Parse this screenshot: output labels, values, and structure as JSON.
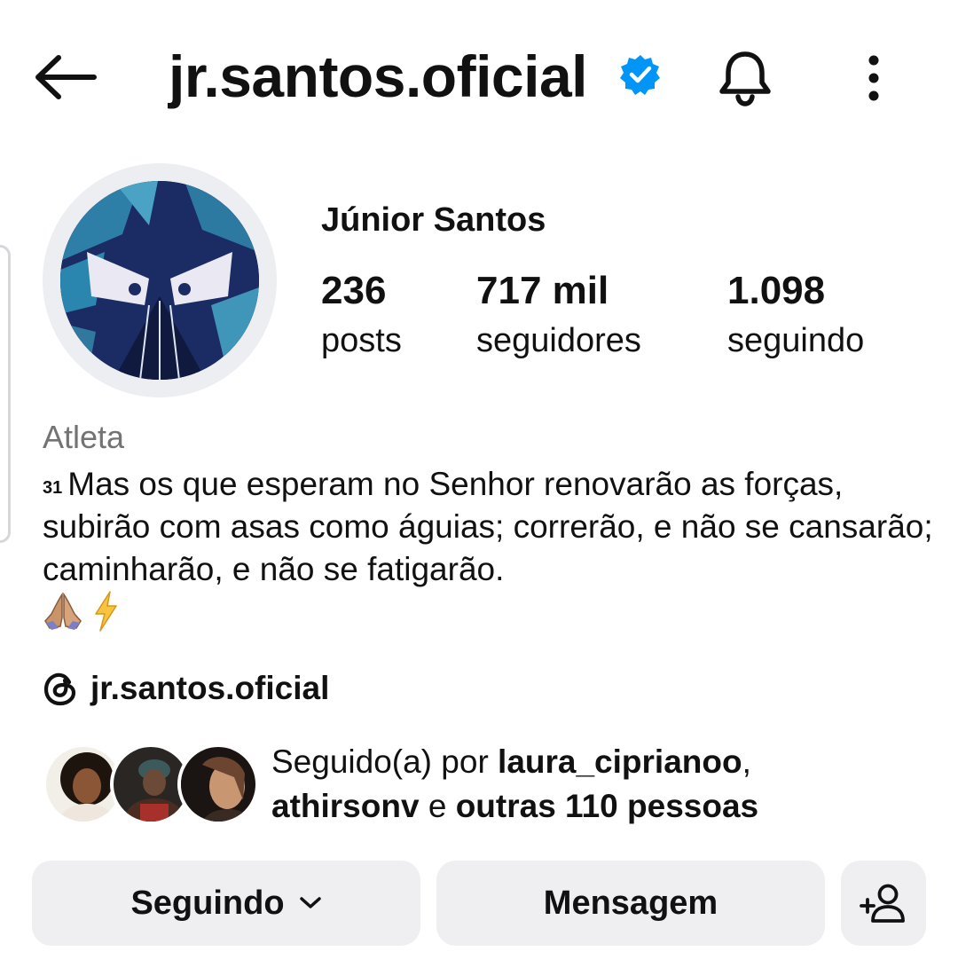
{
  "header": {
    "username": "jr.santos.oficial",
    "icons": {
      "back": "back-arrow-icon",
      "verified": "verified-badge-icon",
      "notifications": "bell-icon",
      "more": "more-vertical-icon"
    }
  },
  "profile": {
    "display_name": "Júnior Santos",
    "stats": {
      "posts": {
        "value": "236",
        "label": "posts"
      },
      "followers": {
        "value": "717 mil",
        "label": "seguidores"
      },
      "following": {
        "value": "1.098",
        "label": "seguindo"
      }
    },
    "category": "Atleta",
    "bio": {
      "verse_number": "31",
      "text": "Mas os que esperam no Senhor renovarão as forças, subirão com asas como águias; correrão, e não se cansarão; caminharão, e não se fatigarão.",
      "emojis": [
        "🙏",
        "⚡"
      ]
    },
    "threads_link": {
      "icon": "threads-icon",
      "text": "jr.santos.oficial"
    }
  },
  "followed_by": {
    "prefix": "Seguido(a) por ",
    "user1": "laura_ciprianoo",
    "separator": ",",
    "user2": "athirsonv",
    "conjunction": " e ",
    "others": "outras 110 pessoas"
  },
  "actions": {
    "following_label": "Seguindo",
    "message_label": "Mensagem",
    "icons": {
      "following_dropdown": "chevron-down-icon",
      "add_user": "add-person-icon"
    }
  },
  "colors": {
    "verified": "#0095f6",
    "button_bg": "#efeff2",
    "secondary_text": "#737373"
  }
}
